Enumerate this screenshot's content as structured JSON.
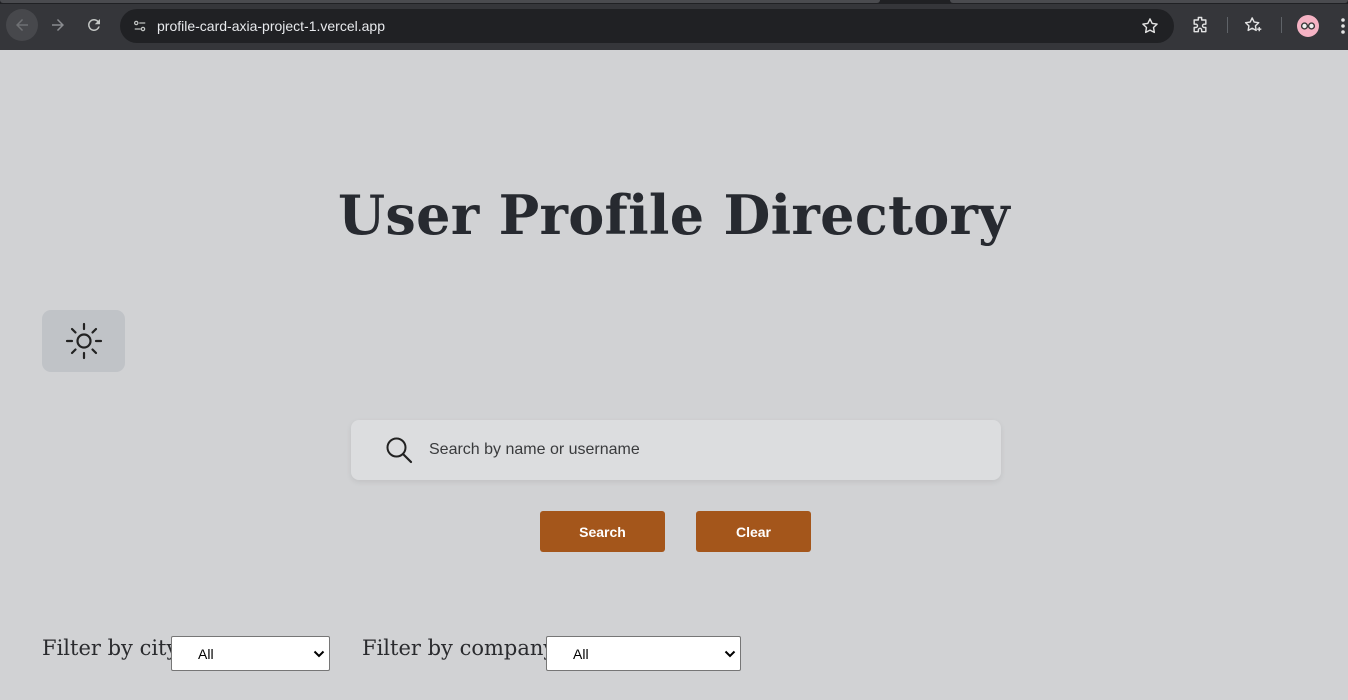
{
  "browser": {
    "url": "profile-card-axia-project-1.vercel.app"
  },
  "page": {
    "title": "User Profile Directory"
  },
  "search": {
    "placeholder": "Search by name or username",
    "value": ""
  },
  "buttons": {
    "search_label": "Search",
    "clear_label": "Clear"
  },
  "filters": {
    "city_label": "Filter by city",
    "city_selected": "All",
    "company_label": "Filter by company",
    "company_selected": "All"
  },
  "colors": {
    "page_background": "#d1d2d4",
    "accent_button": "#a4561b",
    "title_text": "#272a30"
  },
  "icons": {
    "theme_toggle": "sun-icon",
    "search": "magnifier-icon"
  }
}
